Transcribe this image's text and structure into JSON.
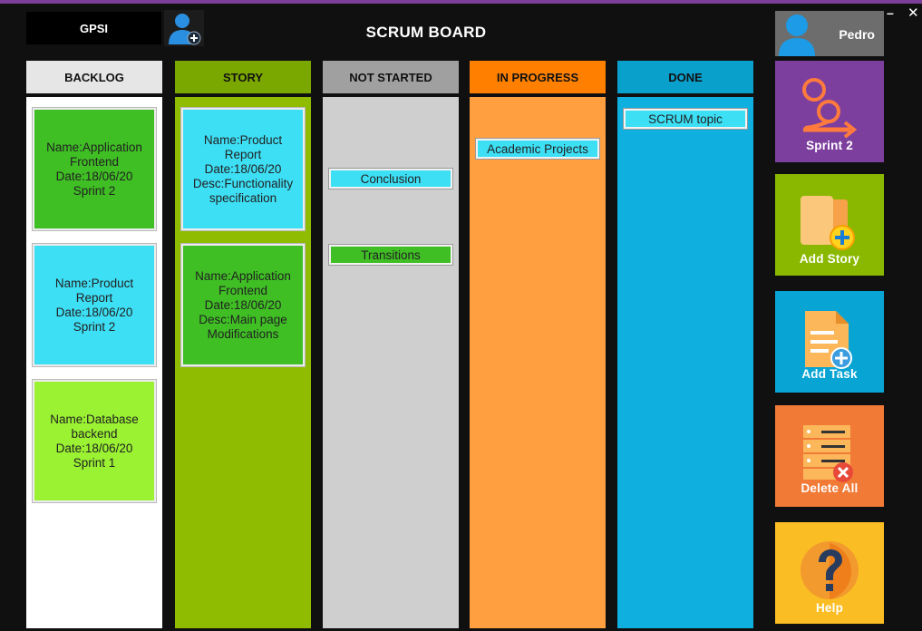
{
  "app": {
    "brand": "GPSI",
    "title": "SCRUM BOARD"
  },
  "window": {
    "minimize": "–",
    "close": "✕"
  },
  "user": {
    "name": "Pedro"
  },
  "columns": [
    {
      "label": "BACKLOG",
      "header_color": "#e6e6e6",
      "body_color": "#ffffff"
    },
    {
      "label": "STORY",
      "header_color": "#7ba800",
      "body_color": "#8fbc00"
    },
    {
      "label": "NOT STARTED",
      "header_color": "#a0a0a0",
      "body_color": "#cfcfcf"
    },
    {
      "label": "IN PROGRESS",
      "header_color": "#ff8000",
      "body_color": "#ff9f40"
    },
    {
      "label": "DONE",
      "header_color": "#0aa0cc",
      "body_color": "#0fb0e0"
    }
  ],
  "backlog_cards": [
    {
      "lines": [
        "Name:Application",
        "Frontend",
        "Date:18/06/20",
        "Sprint 2"
      ],
      "color": "#3fbf24"
    },
    {
      "lines": [
        "Name:Product",
        "Report",
        "Date:18/06/20",
        "Sprint 2"
      ],
      "color": "#3ddff5"
    },
    {
      "lines": [
        "Name:Database",
        "backend",
        "Date:18/06/20",
        "Sprint 1"
      ],
      "color": "#9af232"
    }
  ],
  "story_cards": [
    {
      "lines": [
        "Name:Product",
        "Report",
        "Date:18/06/20",
        "Desc:Functionality",
        "specification"
      ],
      "color": "#3ddff5"
    },
    {
      "lines": [
        "Name:Application",
        "Frontend",
        "Date:18/06/20",
        "Desc:Main page",
        "Modifications"
      ],
      "color": "#3fbf24"
    }
  ],
  "tasks": {
    "not_started": [
      {
        "label": "Conclusion",
        "color": "#3ddff5"
      },
      {
        "label": "Transitions",
        "color": "#3fbf24"
      }
    ],
    "in_progress": [
      {
        "label": "Academic Projects",
        "color": "#3ddff5"
      }
    ],
    "done": [
      {
        "label": "SCRUM topic",
        "color": "#3ddff5"
      }
    ]
  },
  "sidebar": {
    "sprint": {
      "label": "Sprint 2",
      "color": "#7d3f9e",
      "icon": "sprint-cycle-icon"
    },
    "add_story": {
      "label": "Add Story",
      "color": "#8ab800",
      "icon": "folder-add-icon"
    },
    "add_task": {
      "label": "Add Task",
      "color": "#08a4d4",
      "icon": "document-add-icon"
    },
    "delete_all": {
      "label": "Delete All",
      "color": "#f07a36",
      "icon": "server-delete-icon"
    },
    "help": {
      "label": "Help",
      "color": "#fbbd24",
      "icon": "help-icon"
    }
  }
}
